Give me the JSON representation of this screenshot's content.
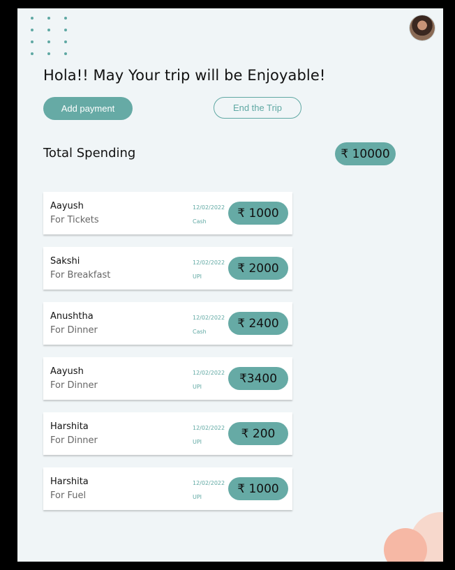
{
  "header": {
    "greeting": "Hola!! May Your trip will be Enjoyable!"
  },
  "actions": {
    "add_payment": "Add payment",
    "end_trip": "End the Trip"
  },
  "total": {
    "label": "Total Spending",
    "amount": "₹ 10000"
  },
  "payments": [
    {
      "name": "Aayush",
      "purpose": "For Tickets",
      "date": "12/02/2022",
      "method": "Cash",
      "amount": "₹ 1000"
    },
    {
      "name": "Sakshi",
      "purpose": "For Breakfast",
      "date": "12/02/2022",
      "method": "UPI",
      "amount": "₹ 2000"
    },
    {
      "name": "Anushtha",
      "purpose": "For Dinner",
      "date": "12/02/2022",
      "method": "Cash",
      "amount": "₹ 2400"
    },
    {
      "name": "Aayush",
      "purpose": "For Dinner",
      "date": "12/02/2022",
      "method": "UPI",
      "amount": "₹3400"
    },
    {
      "name": "Harshita",
      "purpose": "For Dinner",
      "date": "12/02/2022",
      "method": "UPI",
      "amount": "₹ 200"
    },
    {
      "name": "Harshita",
      "purpose": "For Fuel",
      "date": "12/02/2022",
      "method": "UPI",
      "amount": "₹ 1000"
    }
  ],
  "colors": {
    "accent": "#66aaa5",
    "background": "#f0f5f7",
    "blob_light": "#f7d8cc",
    "blob_dark": "#f6b8a5"
  },
  "icons": {
    "decoration": "dot-grid-icon",
    "profile": "avatar-icon"
  }
}
